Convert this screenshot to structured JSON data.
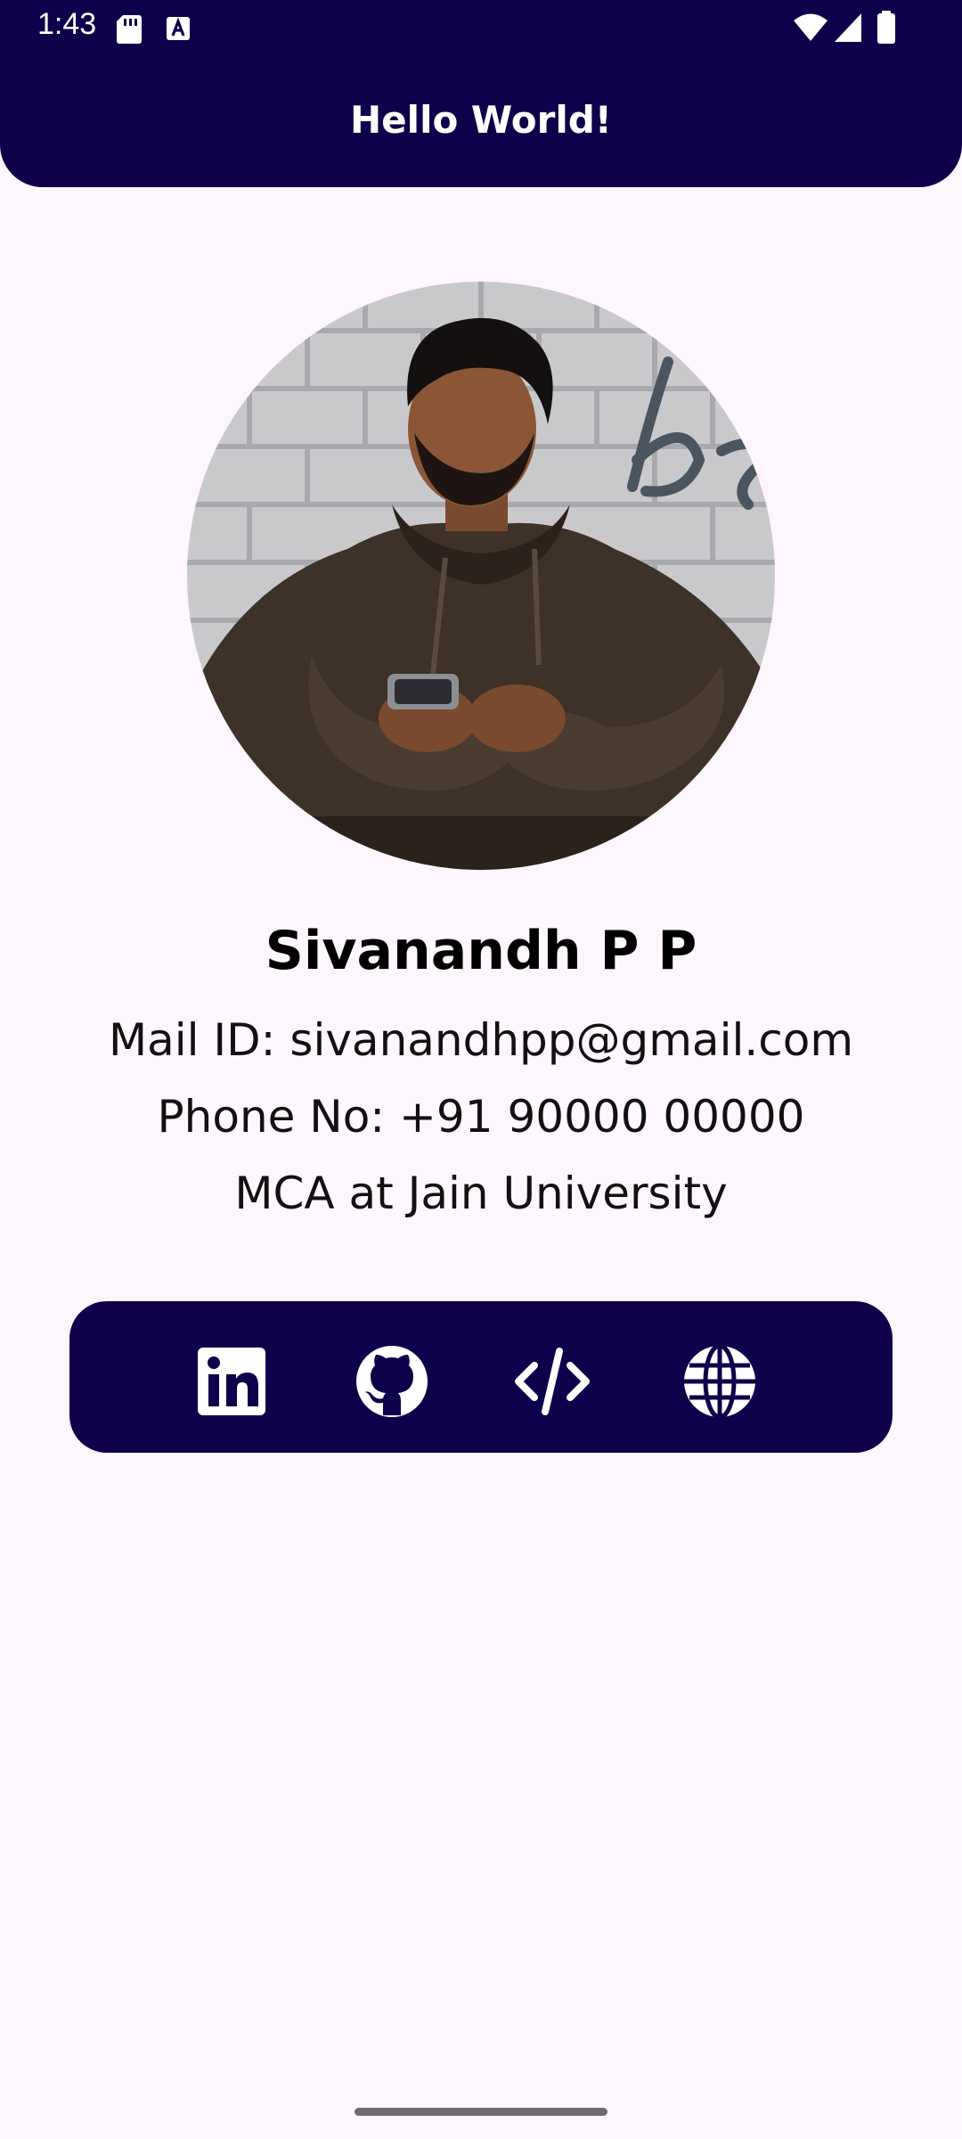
{
  "status_bar": {
    "time": "1:43",
    "icons": [
      "sd-card-icon",
      "keyboard-a-icon",
      "wifi-icon",
      "cell-signal-icon",
      "battery-icon"
    ]
  },
  "app_bar": {
    "title": "Hello World!"
  },
  "profile": {
    "photo": "profile-photo",
    "name": "Sivanandh P P",
    "mail": "Mail ID: sivanandhpp@gmail.com",
    "phone": "Phone No: +91 90000 00000",
    "education": "MCA at Jain University"
  },
  "social_links": [
    {
      "icon": "linkedin-icon"
    },
    {
      "icon": "github-icon"
    },
    {
      "icon": "code-icon"
    },
    {
      "icon": "globe-icon"
    }
  ],
  "colors": {
    "primary": "#0E004A",
    "background": "#FDF7FD",
    "on_primary": "#FFFFFF"
  }
}
